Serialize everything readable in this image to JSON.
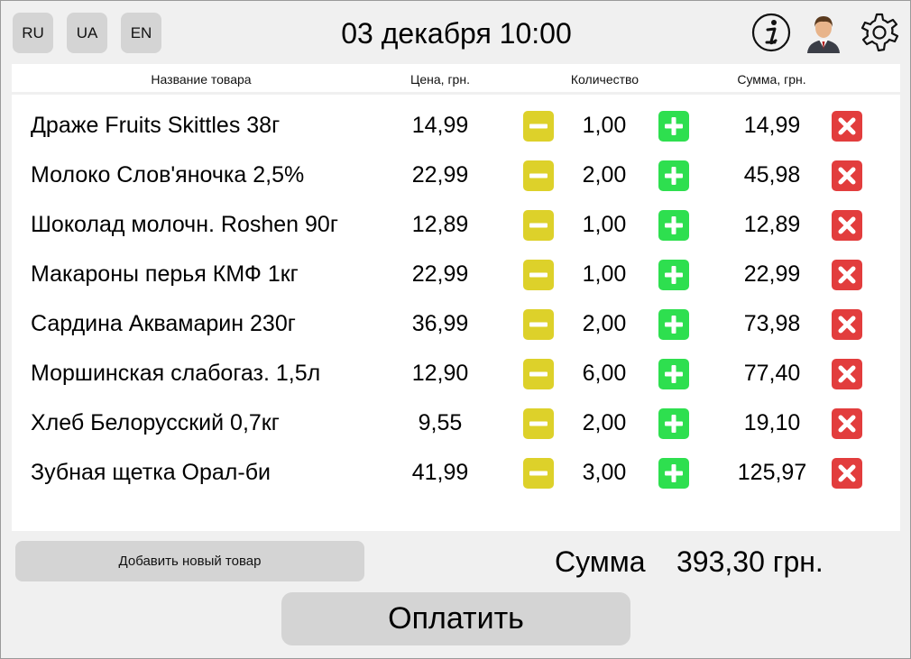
{
  "header": {
    "languages": [
      "RU",
      "UA",
      "EN"
    ],
    "datetime": "03 декабря 10:00",
    "icons": [
      "info-icon",
      "user-avatar-icon",
      "gear-icon"
    ]
  },
  "table": {
    "columns": [
      "Название товара",
      "Цена, грн.",
      "Количество",
      "Сумма, грн."
    ],
    "rows": [
      {
        "name": "Драже Fruits Skittles 38г",
        "price": "14,99",
        "qty": "1,00",
        "sum": "14,99"
      },
      {
        "name": "Молоко Слов'яночка 2,5%",
        "price": "22,99",
        "qty": "2,00",
        "sum": "45,98"
      },
      {
        "name": "Шоколад молочн. Roshen 90г",
        "price": "12,89",
        "qty": "1,00",
        "sum": "12,89"
      },
      {
        "name": "Макароны перья КМФ 1кг",
        "price": "22,99",
        "qty": "1,00",
        "sum": "22,99"
      },
      {
        "name": "Сардина Аквамарин 230г",
        "price": "36,99",
        "qty": "2,00",
        "sum": "73,98"
      },
      {
        "name": "Моршинская слабогаз. 1,5л",
        "price": "12,90",
        "qty": "6,00",
        "sum": "77,40"
      },
      {
        "name": "Хлеб Белорусский 0,7кг",
        "price": "9,55",
        "qty": "2,00",
        "sum": "19,10"
      },
      {
        "name": "Зубная щетка Орал-би",
        "price": "41,99",
        "qty": "3,00",
        "sum": "125,97"
      }
    ],
    "row_icons": {
      "decrease": "minus-icon",
      "increase": "plus-icon",
      "remove": "close-icon"
    }
  },
  "footer": {
    "add_label": "Добавить новый товар",
    "total_label": "Сумма",
    "total_value": "393,30 грн.",
    "pay_label": "Оплатить"
  },
  "colors": {
    "minus": "#ddd12a",
    "plus": "#2edf4f",
    "remove": "#e23d3d",
    "button_gray": "#d4d4d4",
    "background": "#f0f0f0"
  }
}
